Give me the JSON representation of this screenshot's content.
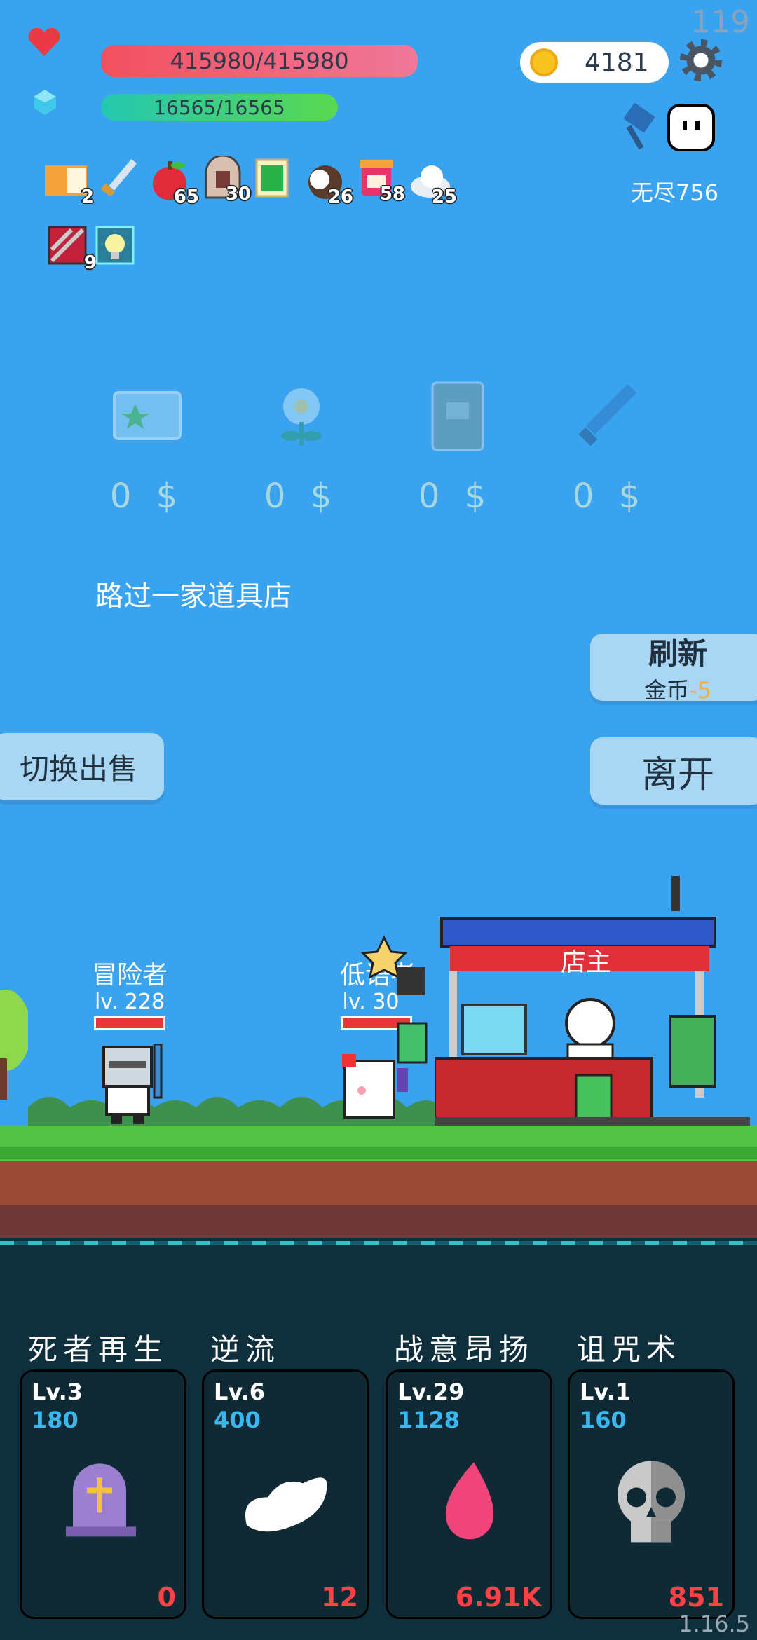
{
  "fps": "119",
  "version": "1.16.5",
  "hud": {
    "hp": "415980/415980",
    "mp": "16565/16565",
    "coins": "4181",
    "endless": "无尽756"
  },
  "inventory": [
    {
      "icon": "scroll-icon",
      "count": "2"
    },
    {
      "icon": "sword-icon",
      "count": ""
    },
    {
      "icon": "apple-icon",
      "count": "65"
    },
    {
      "icon": "tombstone-icon",
      "count": "30"
    },
    {
      "icon": "green-card-icon",
      "count": ""
    },
    {
      "icon": "coconut-icon",
      "count": "26"
    },
    {
      "icon": "jam-jar-icon",
      "count": "58"
    },
    {
      "icon": "cloud-icon",
      "count": "25"
    },
    {
      "icon": "striped-card-icon",
      "count": "9"
    },
    {
      "icon": "lightbulb-icon",
      "count": ""
    }
  ],
  "shop": {
    "items": [
      {
        "icon": "star-card-icon",
        "price": "0 $"
      },
      {
        "icon": "flower-icon",
        "price": "0 $"
      },
      {
        "icon": "book-icon",
        "price": "0 $"
      },
      {
        "icon": "sword-icon",
        "price": "0 $"
      }
    ],
    "event_text": "路过一家道具店",
    "refresh_label": "刷新",
    "refresh_cost_label": "金币",
    "refresh_cost": "-5",
    "switch_label": "切换出售",
    "leave_label": "离开"
  },
  "scene": {
    "hero_name": "冒险者",
    "hero_level": "lv. 228",
    "enemy_name": "低语者",
    "enemy_level": "lv. 30",
    "shopkeeper": "店主"
  },
  "skills": [
    {
      "name": "死者再生",
      "level": "Lv.3",
      "cost": "180",
      "count": "0",
      "icon": "grave-cross-icon"
    },
    {
      "name": "逆流",
      "level": "Lv.6",
      "cost": "400",
      "count": "12",
      "icon": "wing-icon"
    },
    {
      "name": "战意昂扬",
      "level": "Lv.29",
      "cost": "1128",
      "count": "6.91K",
      "icon": "flame-icon"
    },
    {
      "name": "诅咒术",
      "level": "Lv.1",
      "cost": "160",
      "count": "851",
      "icon": "skull-icon"
    }
  ],
  "colors": {
    "sky": "#3aa3f0",
    "hp": "#f2505f",
    "mp": "#5ad84e",
    "skill_cost": "#39b8f0",
    "skill_count": "#ff4045"
  }
}
